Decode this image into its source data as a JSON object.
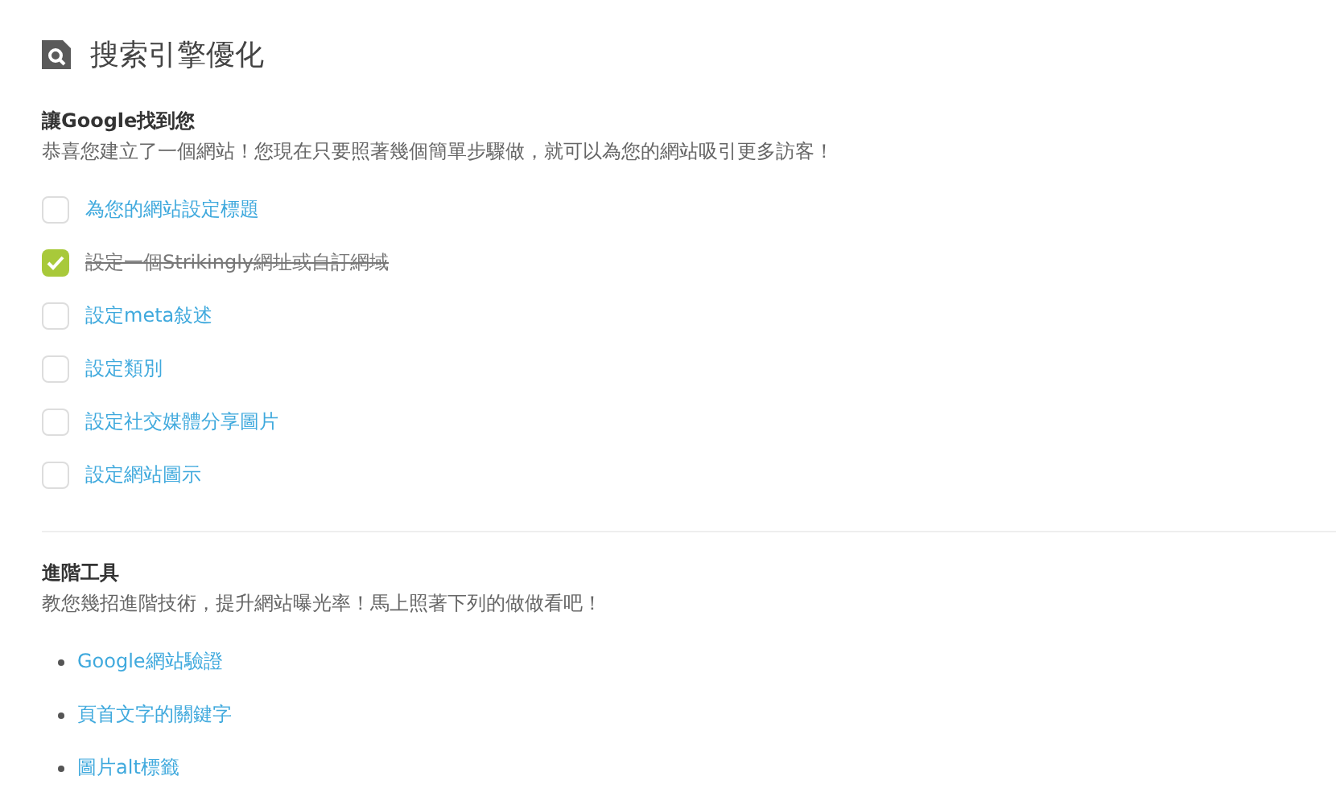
{
  "title": "搜索引擎優化",
  "sections": [
    {
      "heading": "讓Google找到您",
      "description": "恭喜您建立了一個網站！您現在只要照著幾個簡單步驟做，就可以為您的網站吸引更多訪客！",
      "kind": "checklist",
      "items": [
        {
          "label": "為您的網站設定標題",
          "checked": false
        },
        {
          "label": "設定一個Strikingly網址或自訂網域",
          "checked": true
        },
        {
          "label": "設定meta敍述",
          "checked": false
        },
        {
          "label": "設定類別",
          "checked": false
        },
        {
          "label": "設定社交媒體分享圖片",
          "checked": false
        },
        {
          "label": "設定網站圖示",
          "checked": false
        }
      ]
    },
    {
      "heading": "進階工具",
      "description": "教您幾招進階技術，提升網站曝光率！馬上照著下列的做做看吧！",
      "kind": "bullets",
      "items": [
        {
          "label": "Google網站驗證"
        },
        {
          "label": "頁首文字的關鍵字"
        },
        {
          "label": "圖片alt標籤"
        }
      ]
    }
  ]
}
